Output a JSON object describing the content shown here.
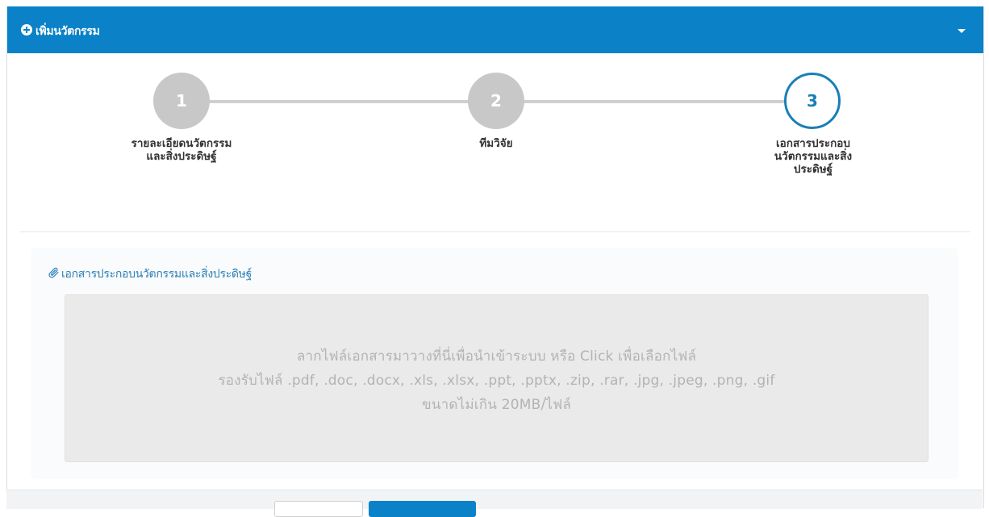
{
  "header": {
    "title": "เพิ่มนวัตกรรม",
    "icons": {
      "left": "plus-circle-icon",
      "right": "caret-down-icon"
    }
  },
  "steps": [
    {
      "number": "1",
      "label": "รายละเอียดนวัตกรรมและสิ่งประดิษฐ์",
      "state": "done"
    },
    {
      "number": "2",
      "label": "ทีมวิจัย",
      "state": "done"
    },
    {
      "number": "3",
      "label": "เอกสารประกอบนวัตกรรมและสิ่งประดิษฐ์",
      "state": "active"
    }
  ],
  "section": {
    "title": "เอกสารประกอบนวัตกรรมและสิ่งประดิษฐ์",
    "icon": "paperclip-icon"
  },
  "dropzone": {
    "line1": "ลากไฟล์เอกสารมาวางที่นี่เพื่อนำเข้าระบบ หรือ Click เพื่อเลือกไฟล์",
    "line2": "รองรับไฟล์ .pdf, .doc, .docx, .xls, .xlsx, .ppt, .pptx, .zip, .rar, .jpg, .jpeg, .png, .gif",
    "line3": "ขนาดไม่เกิน 20MB/ไฟล์"
  },
  "colors": {
    "primary": "#0b82c8",
    "step_done": "#c8c8c8",
    "step_active": "#1a7fb8",
    "section_title": "#2b7fb6"
  }
}
